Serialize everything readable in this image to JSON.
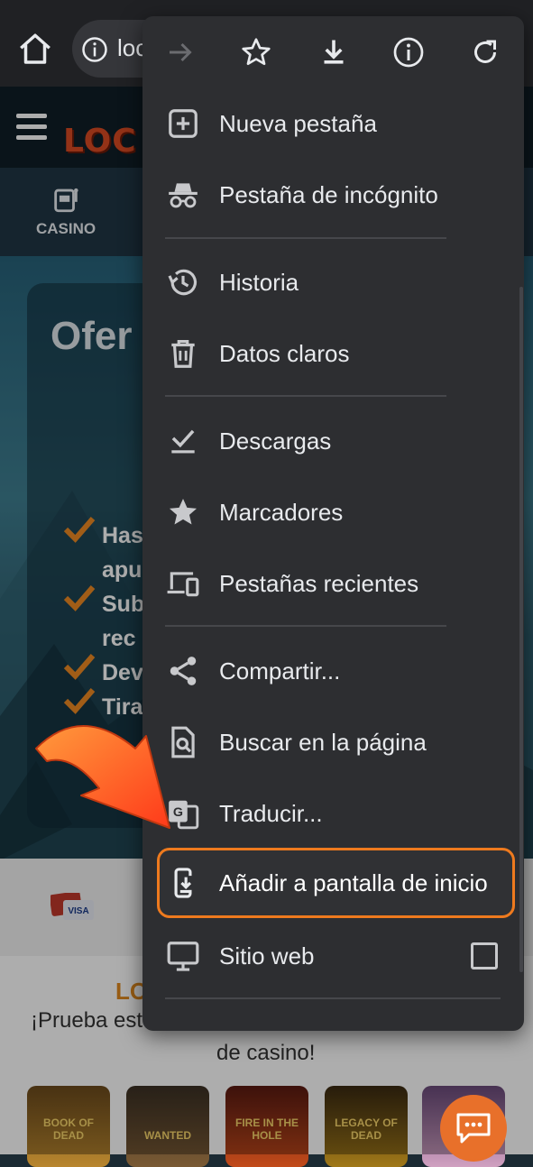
{
  "browser": {
    "url_text": "loc",
    "home_icon": "home-icon",
    "info_icon": "info-icon"
  },
  "site": {
    "logo_text": "LOC",
    "nav_casino_label": "CASINO",
    "hero_title": "Ofer",
    "bullets": [
      "Has",
      "apu",
      "Sub",
      "rec",
      "Dev",
      "Tira"
    ],
    "promo_brand": "LO",
    "promo_line1": "¡Prueba est",
    "promo_line2": "de casino!",
    "payment_label": "VISA",
    "games": [
      "BOOK OF DEAD",
      "WANTED",
      "FIRE IN THE HOLE",
      "LEGACY OF DEAD",
      ""
    ]
  },
  "menu": {
    "toolbar": [
      "forward-arrow-icon",
      "star-icon",
      "download-icon",
      "info-icon",
      "reload-icon"
    ],
    "items": [
      {
        "label": "Nueva pestaña",
        "icon": "new-tab-icon"
      },
      {
        "label": "Pestaña de incógnito",
        "icon": "incognito-icon"
      },
      {
        "label": "Historia",
        "icon": "history-icon"
      },
      {
        "label": "Datos claros",
        "icon": "trash-icon"
      },
      {
        "label": "Descargas",
        "icon": "downloads-icon"
      },
      {
        "label": "Marcadores",
        "icon": "star-icon"
      },
      {
        "label": "Pestañas recientes",
        "icon": "devices-icon"
      },
      {
        "label": "Compartir...",
        "icon": "share-icon"
      },
      {
        "label": "Buscar en la página",
        "icon": "find-in-page-icon"
      },
      {
        "label": "Traducir...",
        "icon": "translate-icon"
      },
      {
        "label": "Añadir a pantalla de inicio",
        "icon": "add-to-home-icon"
      },
      {
        "label": "Sitio web",
        "icon": "desktop-icon"
      }
    ],
    "desktop_site_checked": false
  },
  "colors": {
    "menu_bg": "#2d2e31",
    "highlight_border": "#ee7a1e",
    "arrow": "#ff5a1c"
  }
}
